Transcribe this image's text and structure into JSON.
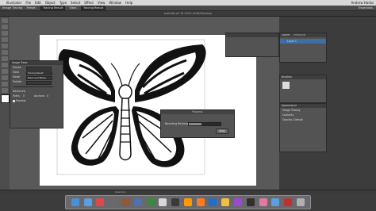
{
  "menu": {
    "app": "Illustrator",
    "items": [
      "File",
      "Edit",
      "Object",
      "Type",
      "Select",
      "Effect",
      "View",
      "Window",
      "Help"
    ],
    "right": "Andrew Harbo"
  },
  "control": {
    "mode": "Image Tracing",
    "preset_label": "Preset:",
    "preset_value": "Tracing Result",
    "view_label": "View:",
    "view_value": "Tracing Result",
    "workspace": "Essentials"
  },
  "document": {
    "title": "butterfly.ai* @ 100% (RGB/Preview)"
  },
  "image_trace": {
    "title": "Image Trace",
    "preset_label": "Preset:",
    "view_label": "View:",
    "view_value": "Tracing Result",
    "mode_label": "Mode:",
    "mode_value": "Black and White",
    "palette_label": "Palette:",
    "advanced_label": "Advanced",
    "paths_label": "Paths:",
    "paths_value": "0",
    "anchors_label": "Anchors:",
    "anchors_value": "0",
    "preview_label": "Preview"
  },
  "progress": {
    "title": "Progress",
    "label": "Bounding Rectangles...",
    "fraction": 0.4,
    "stop_label": "Stop"
  },
  "panels": {
    "layers_tab": "Layers",
    "artboards_tab": "Artboards",
    "layer1": "Layer 1",
    "brushes_tab": "Brushes",
    "appearance_tab": "Appearance",
    "appearance_item": "Image Tracing",
    "contents": "Contents",
    "opacity": "Opacity: Default"
  },
  "status": {
    "zoom": "Selection"
  },
  "dock": {
    "colors": [
      "#4a90d9",
      "#5aa0e0",
      "#e04848",
      "#6a6a6a",
      "#8a5a3a",
      "#5070b0",
      "#3a8a3a",
      "#d8d8d8",
      "#3a3a3a",
      "#ff9a00",
      "#ff7a20",
      "#1f6fd0",
      "#f0c040",
      "#9a4ad0",
      "#2f2f2f",
      "#e07aa0",
      "#5aa0e0",
      "#c03030",
      "#b0b0b0"
    ]
  }
}
